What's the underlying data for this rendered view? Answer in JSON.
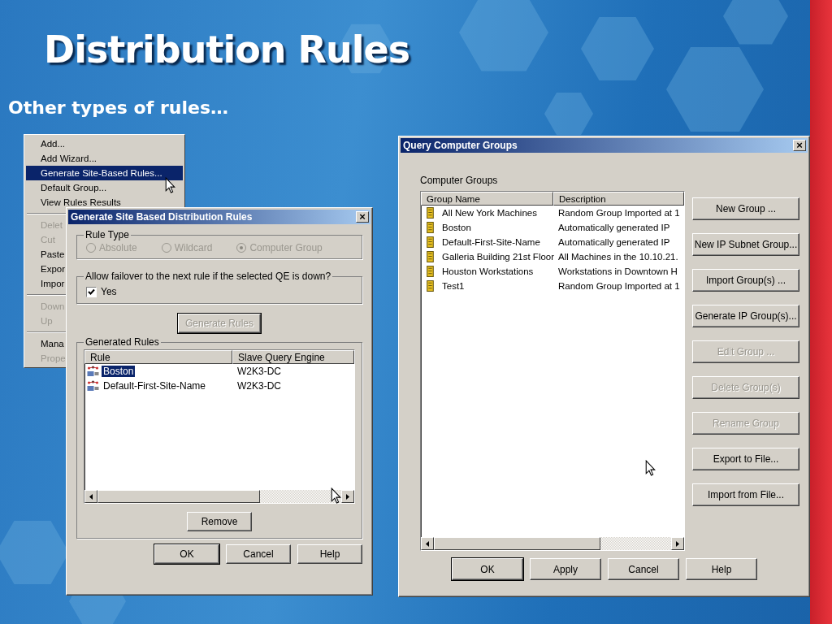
{
  "slide": {
    "title": "Distribution Rules",
    "subtitle": "Other types of rules…"
  },
  "context_menu": {
    "sections": [
      [
        {
          "label": "Add...",
          "disabled": false,
          "selected": false
        },
        {
          "label": "Add Wizard...",
          "disabled": false,
          "selected": false
        },
        {
          "label": "Generate Site-Based Rules...",
          "disabled": false,
          "selected": true
        },
        {
          "label": "Default Group...",
          "disabled": false,
          "selected": false
        },
        {
          "label": "View Rules Results",
          "disabled": false,
          "selected": false
        }
      ],
      [
        {
          "label": "Delet",
          "disabled": true,
          "selected": false
        },
        {
          "label": "Cut",
          "disabled": true,
          "selected": false
        },
        {
          "label": "Paste",
          "disabled": false,
          "selected": false
        },
        {
          "label": "Expor",
          "disabled": false,
          "selected": false
        },
        {
          "label": "Impor",
          "disabled": false,
          "selected": false
        }
      ],
      [
        {
          "label": "Down",
          "disabled": true,
          "selected": false
        },
        {
          "label": "Up",
          "disabled": true,
          "selected": false
        }
      ],
      [
        {
          "label": "Mana",
          "disabled": false,
          "selected": false
        },
        {
          "label": "Prope",
          "disabled": true,
          "selected": false
        }
      ]
    ]
  },
  "site_dialog": {
    "title": "Generate Site Based Distribution Rules",
    "close": "×",
    "rule_type": {
      "label": "Rule Type",
      "options": [
        {
          "label": "Absolute",
          "selected": false,
          "disabled": true
        },
        {
          "label": "Wildcard",
          "selected": false,
          "disabled": true
        },
        {
          "label": "Computer Group",
          "selected": true,
          "disabled": true
        }
      ]
    },
    "failover": {
      "label": "Allow failover to the next rule if the selected QE is down?",
      "checkbox": {
        "label": "Yes",
        "checked": true
      }
    },
    "generate_button": {
      "label": "Generate Rules",
      "disabled": true
    },
    "generated_rules": {
      "label": "Generated Rules",
      "columns": [
        "Rule",
        "Slave Query Engine"
      ],
      "rows": [
        {
          "cells": [
            "Boston",
            "W2K3-DC"
          ],
          "selected": true
        },
        {
          "cells": [
            "Default-First-Site-Name",
            "W2K3-DC"
          ],
          "selected": false
        }
      ]
    },
    "remove_button": "Remove",
    "buttons": [
      "OK",
      "Cancel",
      "Help"
    ]
  },
  "groups_dialog": {
    "title": "Query Computer Groups",
    "close": "×",
    "list_label": "Computer Groups",
    "columns": [
      "Group Name",
      "Description"
    ],
    "rows": [
      {
        "cells": [
          "All New York Machines",
          "Random Group Imported at  1"
        ]
      },
      {
        "cells": [
          "Boston",
          "Automatically generated IP"
        ]
      },
      {
        "cells": [
          "Default-First-Site-Name",
          "Automatically generated IP"
        ]
      },
      {
        "cells": [
          "Galleria Building 21st Floor",
          "All Machines in the 10.10.21."
        ]
      },
      {
        "cells": [
          "Houston Workstations",
          "Workstations in Downtown H"
        ]
      },
      {
        "cells": [
          "Test1",
          "Random Group Imported at  1"
        ]
      }
    ],
    "side_buttons": [
      {
        "label": "New Group ...",
        "disabled": false
      },
      {
        "label": "New IP Subnet Group...",
        "disabled": false
      },
      {
        "label": "Import Group(s) ...",
        "disabled": false
      },
      {
        "label": "Generate IP Group(s)...",
        "disabled": false
      },
      {
        "label": "Edit Group ...",
        "disabled": true
      },
      {
        "label": "Delete Group(s)",
        "disabled": true
      },
      {
        "label": "Rename Group",
        "disabled": true
      },
      {
        "label": "Export to File...",
        "disabled": false
      },
      {
        "label": "Import from File...",
        "disabled": false
      }
    ],
    "buttons": [
      "OK",
      "Apply",
      "Cancel",
      "Help"
    ]
  }
}
